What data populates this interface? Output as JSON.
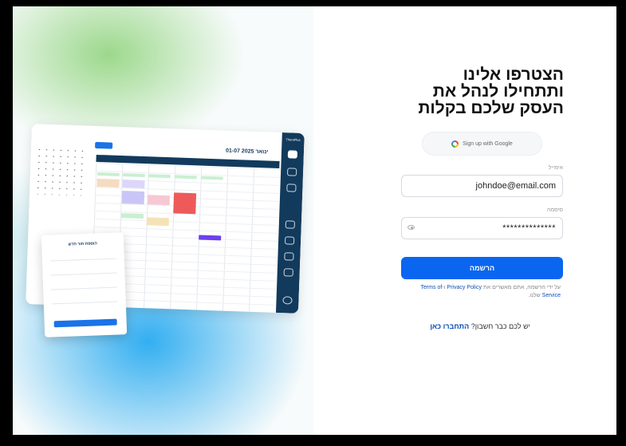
{
  "form": {
    "heading_lines": [
      "הצטרפו אלינו",
      "ותתחילו לנהל את",
      "העסק שלכם בקלות"
    ],
    "google_button": "Sign up with Google",
    "email_label": "אימייל",
    "email_value": "johndoe@email.com",
    "password_label": "סיסמה",
    "password_value": "**************",
    "submit_label": "הרשמה",
    "terms_prefix": "על ידי הרשמה, אתם מאשרים את",
    "privacy_link": "Privacy Policy",
    "terms_and": "ו-",
    "terms_link": "Terms of Service",
    "terms_suffix": "שלנו.",
    "login_prompt": "יש לכם כבר חשבון?",
    "login_link": "התחברו כאן"
  },
  "mockup": {
    "brand": "TherePlus",
    "date_title": "01-07 ינואר 2025",
    "popup_title": "הוספת תור חדש"
  },
  "colors": {
    "primary": "#0a66f0",
    "sidebar": "#123a5c"
  }
}
